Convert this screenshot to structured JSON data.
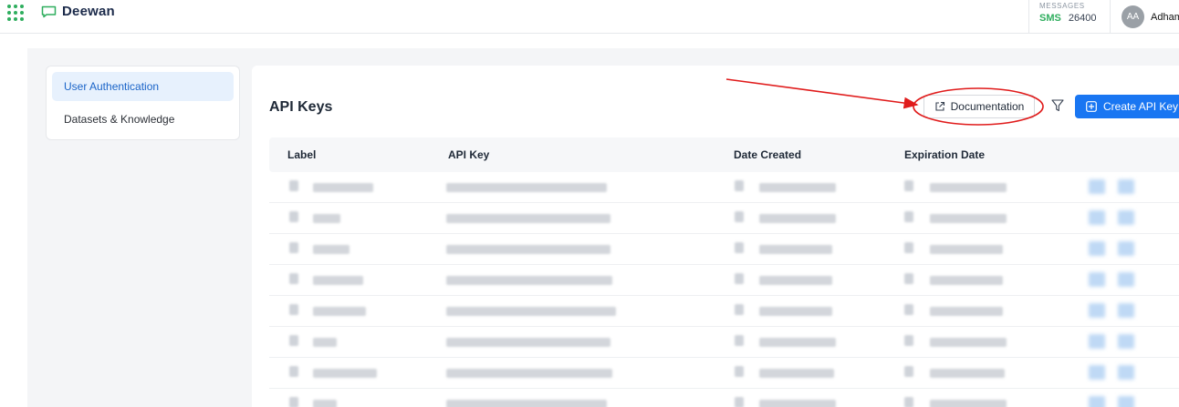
{
  "header": {
    "brand": "Deewan",
    "messages_label": "MESSAGES",
    "sms_label": "SMS",
    "sms_count": "26400",
    "avatar_initials": "AA",
    "user_name": "Adham"
  },
  "sidebar": {
    "items": [
      {
        "label": "User Authentication",
        "active": true
      },
      {
        "label": "Datasets & Knowledge",
        "active": false
      }
    ]
  },
  "main": {
    "title": "API Keys",
    "documentation_label": "Documentation",
    "create_label": "Create API Key",
    "columns": [
      "Label",
      "API Key",
      "Date Created",
      "Expiration Date"
    ]
  },
  "colors": {
    "accent": "#1976f2",
    "brand_green": "#2fae5e",
    "annotation_red": "#e01b1b"
  },
  "icons": [
    "apps-grid-icon",
    "chat-bubble-icon",
    "external-link-icon",
    "filter-icon",
    "plus-square-icon",
    "copy-icon",
    "calendar-icon",
    "edit-icon",
    "delete-icon"
  ]
}
